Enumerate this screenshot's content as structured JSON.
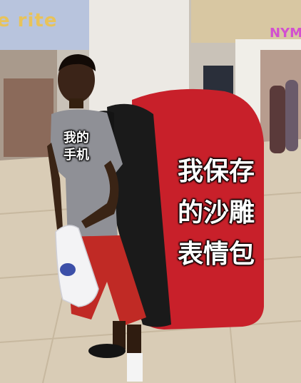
{
  "meme": {
    "phone_caption": "我的\n手机",
    "bag_caption": "我保存\n的沙雕\n表情包"
  },
  "background_signs": {
    "left_store": "e rite",
    "right_store": "NYM"
  },
  "colors": {
    "bag_red": "#c8202a",
    "bag_black": "#1a1a1a",
    "floor": "#d9ccb6",
    "shirt_gray": "#8f9096",
    "shorts_red": "#c02a25"
  }
}
